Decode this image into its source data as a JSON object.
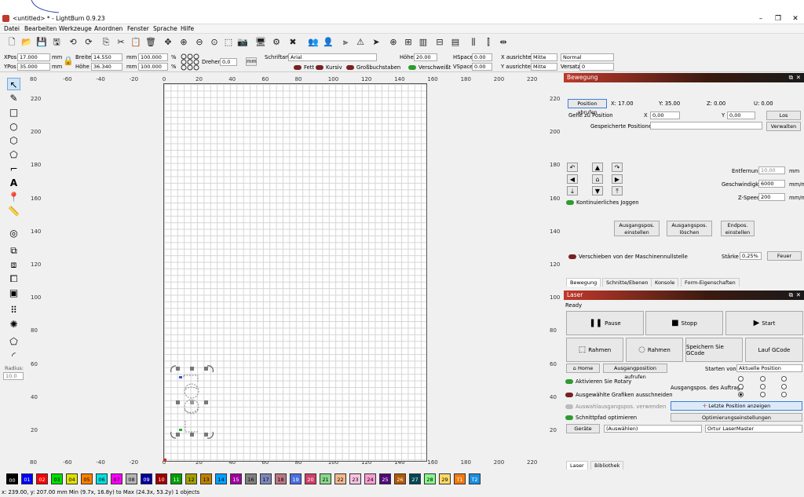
{
  "window": {
    "title": "<untitled> * - LightBurn 0.9.23"
  },
  "menu": [
    "Datei",
    "Bearbeiten",
    "Werkzeuge",
    "Anordnen",
    "Fenster",
    "Sprache",
    "Hilfe"
  ],
  "props": {
    "xpos_label": "XPos",
    "xpos": "17.000",
    "ypos_label": "YPos",
    "ypos": "35.000",
    "unit": "mm",
    "breite_label": "Breite",
    "breite": "14.550",
    "hoehe_label": "Höhe",
    "hoehe": "36.340",
    "pct1": "100.000",
    "pct2": "100.000",
    "pct_unit": "%",
    "drehen_label": "Drehen",
    "drehen": "0,0",
    "mm_btn": "mm",
    "schriftart_label": "Schriftart",
    "schriftart": "Arial",
    "font_hoehe_label": "Höhe",
    "font_hoehe": "20.00",
    "hspace_label": "HSpace",
    "hspace": "0.00",
    "vspace_label": "VSpace",
    "vspace": "0.00",
    "x_ausrichten_label": "X ausrichten",
    "x_ausrichten": "Mitte",
    "y_ausrichten_label": "Y ausrichten",
    "y_ausrichten": "Mitte",
    "normal": "Normal",
    "versatz_label": "Versatz",
    "versatz": "0",
    "fett": "Fett",
    "kursiv": "Kursiv",
    "gross": "Großbuchstaben",
    "verschweisst": "Verschweißt"
  },
  "rulers": {
    "top": [
      "80",
      "-60",
      "-40",
      "-20",
      "0",
      "20",
      "40",
      "60",
      "80",
      "100",
      "120",
      "140",
      "160",
      "180",
      "200",
      "220"
    ],
    "bottom": [
      "80",
      "-60",
      "-40",
      "-20",
      "0",
      "20",
      "40",
      "60",
      "80",
      "100",
      "120",
      "140",
      "160",
      "180",
      "200",
      "220"
    ],
    "left": [
      "220",
      "200",
      "180",
      "160",
      "140",
      "120",
      "100",
      "80",
      "60",
      "40",
      "20"
    ],
    "right": [
      "220",
      "200",
      "180",
      "160",
      "140",
      "120",
      "100",
      "80",
      "60",
      "40",
      "20"
    ]
  },
  "tools": {
    "radius_label": "Radius:",
    "radius": "10.0"
  },
  "move": {
    "title": "Bewegung",
    "get_pos": "Position abrufen",
    "x": "X: 17.00",
    "y": "Y: 35.00",
    "z": "Z: 0.00",
    "u": "U: 0.00",
    "goto": "Gehe zu Position",
    "gx_label": "X",
    "gx": "0,00",
    "gy_label": "Y",
    "gy": "0,00",
    "go": "Los",
    "saved": "Gespeicherte Positionen:",
    "manage": "Verwalten",
    "dist_label": "Entfernung",
    "dist": "10,00",
    "dist_unit": "mm",
    "speed_label": "Geschwindigkeit",
    "speed": "6000",
    "speed_unit": "mm/m",
    "zspeed_label": "Z-Speed",
    "zspeed": "200",
    "zspeed_unit": "mm/m",
    "cont_jog": "Kontinuierliches Joggen",
    "set_origin": [
      "Ausgangspos.",
      "einstellen"
    ],
    "clear_origin": [
      "Ausgangspos.",
      "löschen"
    ],
    "set_end": [
      "Endpos.",
      "einstellen"
    ],
    "offset": "Verschieben von der Maschinennullstelle",
    "power_label": "Stärke",
    "power": "0,25%",
    "fire": "Feuer"
  },
  "tabs1": [
    "Bewegung",
    "Schnitte/Ebenen",
    "Konsole",
    "Form-Eigenschaften"
  ],
  "laser": {
    "title": "Laser",
    "status": "Ready",
    "pause": "Pause",
    "stop": "Stopp",
    "start": "Start",
    "frame1": "Rahmen",
    "frame2": "Rahmen",
    "save_gcode": "Speichern Sie GCode",
    "run_gcode": "Lauf GCode",
    "home": "Home",
    "goto_origin": "Ausgangposition aufrufen",
    "start_from_label": "Starten von:",
    "start_from": "Aktuelle Position",
    "rotary": "Aktivieren Sie Rotary",
    "cut_selected": "Ausgewählte Grafiken ausschneiden",
    "use_sel_origin": "Auswahlausgangspos. verwenden",
    "optimize": "Schnittpfad optimieren",
    "job_origin": "Ausgangspos. des Auftrags",
    "show_last": "Letzte Position anzeigen",
    "opt_settings": "Optimierungseinstellungen",
    "devices": "Geräte",
    "auto": "(Auswählen)",
    "device": "Ortur LaserMaster"
  },
  "tabs2": [
    "Laser",
    "Bibliothek"
  ],
  "palette": [
    {
      "l": "00",
      "c": "#000000",
      "t": "#fff"
    },
    {
      "l": "01",
      "c": "#0000ff",
      "t": "#fff"
    },
    {
      "l": "02",
      "c": "#ff0000",
      "t": "#fff"
    },
    {
      "l": "03",
      "c": "#00e000",
      "t": "#000"
    },
    {
      "l": "04",
      "c": "#e0e000",
      "t": "#000"
    },
    {
      "l": "05",
      "c": "#ff8000",
      "t": "#000"
    },
    {
      "l": "06",
      "c": "#00e0e0",
      "t": "#000"
    },
    {
      "l": "07",
      "c": "#ff00ff",
      "t": "#000"
    },
    {
      "l": "08",
      "c": "#b4b4b4",
      "t": "#000"
    },
    {
      "l": "09",
      "c": "#0000a0",
      "t": "#fff"
    },
    {
      "l": "10",
      "c": "#a00000",
      "t": "#fff"
    },
    {
      "l": "11",
      "c": "#00a000",
      "t": "#fff"
    },
    {
      "l": "12",
      "c": "#a0a000",
      "t": "#000"
    },
    {
      "l": "13",
      "c": "#c08000",
      "t": "#000"
    },
    {
      "l": "14",
      "c": "#00a0ff",
      "t": "#000"
    },
    {
      "l": "15",
      "c": "#a000a0",
      "t": "#fff"
    },
    {
      "l": "16",
      "c": "#808080",
      "t": "#000"
    },
    {
      "l": "17",
      "c": "#7d87b9",
      "t": "#000"
    },
    {
      "l": "18",
      "c": "#bb7784",
      "t": "#000"
    },
    {
      "l": "19",
      "c": "#4a6fe3",
      "t": "#fff"
    },
    {
      "l": "20",
      "c": "#d33f6a",
      "t": "#fff"
    },
    {
      "l": "21",
      "c": "#8cd78c",
      "t": "#000"
    },
    {
      "l": "22",
      "c": "#f0b98d",
      "t": "#000"
    },
    {
      "l": "23",
      "c": "#f6c4e1",
      "t": "#000"
    },
    {
      "l": "24",
      "c": "#fa9ed4",
      "t": "#000"
    },
    {
      "l": "25",
      "c": "#500a78",
      "t": "#fff"
    },
    {
      "l": "26",
      "c": "#b45a00",
      "t": "#fff"
    },
    {
      "l": "27",
      "c": "#004754",
      "t": "#fff"
    },
    {
      "l": "28",
      "c": "#86fa88",
      "t": "#000"
    },
    {
      "l": "29",
      "c": "#ffdb66",
      "t": "#000"
    },
    {
      "l": "T1",
      "c": "#f37a0e",
      "t": "#fff"
    },
    {
      "l": "T2",
      "c": "#1a8fe0",
      "t": "#fff"
    }
  ],
  "status": "x: 239.00, y: 207.00 mm    Min (9.7x, 16.8y) to Max (24.3x, 53.2y)    1 objects"
}
